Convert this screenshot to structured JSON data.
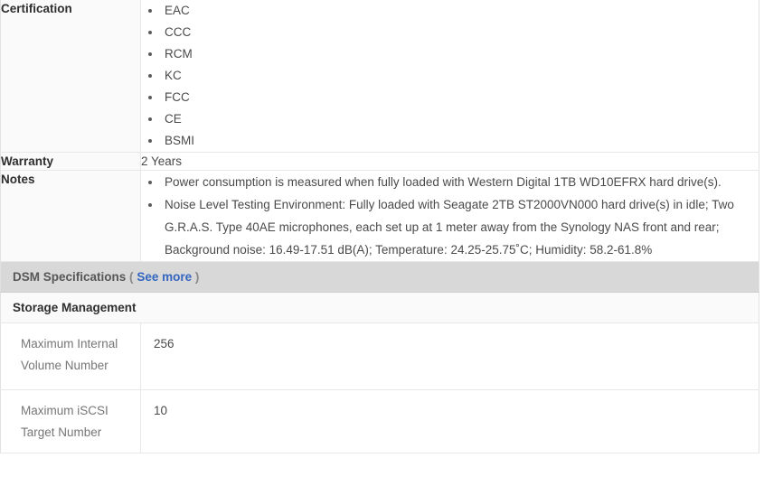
{
  "table": {
    "rows": [
      {
        "label": "Certification",
        "type": "bullets",
        "items": [
          "EAC",
          "CCC",
          "RCM",
          "KC",
          "FCC",
          "CE",
          "BSMI"
        ]
      },
      {
        "label": "Warranty",
        "type": "text",
        "value": "2 Years"
      },
      {
        "label": "Notes",
        "type": "bullets",
        "items": [
          "Power consumption is measured when fully loaded with Western Digital 1TB WD10EFRX hard drive(s).",
          "Noise Level Testing Environment: Fully loaded with Seagate 2TB ST2000VN000 hard drive(s) in idle; Two G.R.A.S. Type 40AE microphones, each set up at 1 meter away from the Synology NAS front and rear; Background noise: 16.49-17.51 dB(A); Temperature: 24.25-25.75˚C; Humidity: 58.2-61.8%"
        ]
      }
    ]
  },
  "dsm_section": {
    "title": "DSM Specifications",
    "link_open_paren": "(",
    "link_label": "See more",
    "link_close_paren": ")",
    "link_color": "#3465c0",
    "band_bg": "#d8d8d8",
    "subsection_title": "Storage Management",
    "rows": [
      {
        "label": "Maximum Internal Volume Number",
        "value": "256"
      },
      {
        "label": "Maximum iSCSI Target Number",
        "value": "10"
      }
    ]
  }
}
